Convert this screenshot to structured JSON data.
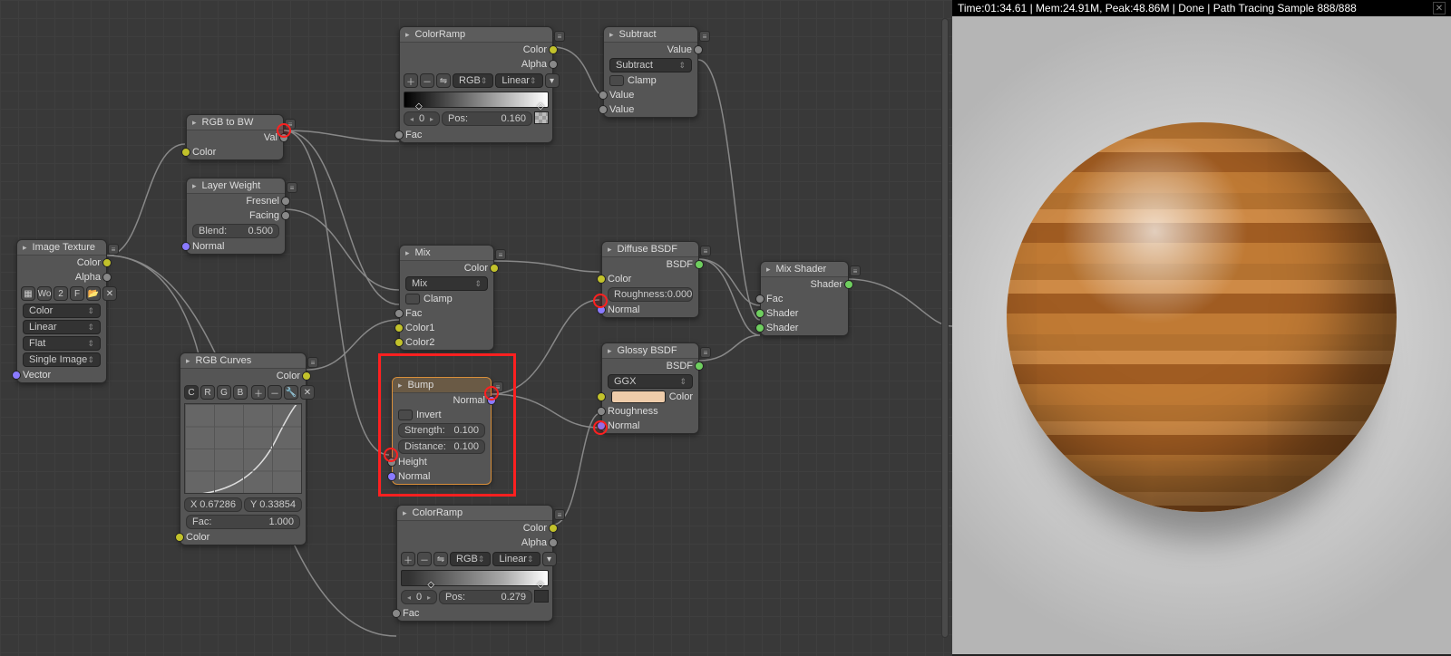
{
  "status_bar": "Time:01:34.61 | Mem:24.91M, Peak:48.86M | Done | Path Tracing Sample 888/888",
  "nodes": {
    "image_texture": {
      "title": "Image Texture",
      "out_color": "Color",
      "out_alpha": "Alpha",
      "img_name": "Wo",
      "btns": [
        "2",
        "F"
      ],
      "color_space": "Color",
      "interp": "Linear",
      "proj": "Flat",
      "source": "Single Image",
      "in_vector": "Vector"
    },
    "rgb_to_bw": {
      "title": "RGB to BW",
      "out": "Val",
      "in": "Color"
    },
    "layer_weight": {
      "title": "Layer Weight",
      "out1": "Fresnel",
      "out2": "Facing",
      "blend_lbl": "Blend:",
      "blend_val": "0.500",
      "in": "Normal"
    },
    "rgb_curves": {
      "title": "RGB Curves",
      "out": "Color",
      "tabs": [
        "C",
        "R",
        "G",
        "B"
      ],
      "x_lbl": "X",
      "x_val": "0.67286",
      "y_lbl": "Y",
      "y_val": "0.33854",
      "fac_lbl": "Fac:",
      "fac_val": "1.000",
      "in_color": "Color"
    },
    "colorramp1": {
      "title": "ColorRamp",
      "out_color": "Color",
      "out_alpha": "Alpha",
      "mode": "RGB",
      "interp": "Linear",
      "idx": "0",
      "pos_lbl": "Pos:",
      "pos_val": "0.160",
      "in": "Fac"
    },
    "colorramp2": {
      "title": "ColorRamp",
      "out_color": "Color",
      "out_alpha": "Alpha",
      "mode": "RGB",
      "interp": "Linear",
      "idx": "0",
      "pos_lbl": "Pos:",
      "pos_val": "0.279",
      "in": "Fac"
    },
    "mix": {
      "title": "Mix",
      "out": "Color",
      "type": "Mix",
      "clamp": "Clamp",
      "fac": "Fac",
      "c1": "Color1",
      "c2": "Color2"
    },
    "subtract": {
      "title": "Subtract",
      "out": "Value",
      "type": "Subtract",
      "clamp": "Clamp",
      "v1": "Value",
      "v2": "Value"
    },
    "diffuse": {
      "title": "Diffuse BSDF",
      "out": "BSDF",
      "color": "Color",
      "rough_lbl": "Roughness:",
      "rough_val": "0.000",
      "normal": "Normal"
    },
    "glossy": {
      "title": "Glossy BSDF",
      "out": "BSDF",
      "dist": "GGX",
      "color": "Color",
      "rough": "Roughness",
      "normal": "Normal"
    },
    "mixshader": {
      "title": "Mix Shader",
      "out": "Shader",
      "fac": "Fac",
      "s1": "Shader",
      "s2": "Shader"
    },
    "bump": {
      "title": "Bump",
      "out": "Normal",
      "invert": "Invert",
      "str_lbl": "Strength:",
      "str_val": "0.100",
      "dist_lbl": "Distance:",
      "dist_val": "0.100",
      "height": "Height",
      "normal": "Normal"
    }
  }
}
